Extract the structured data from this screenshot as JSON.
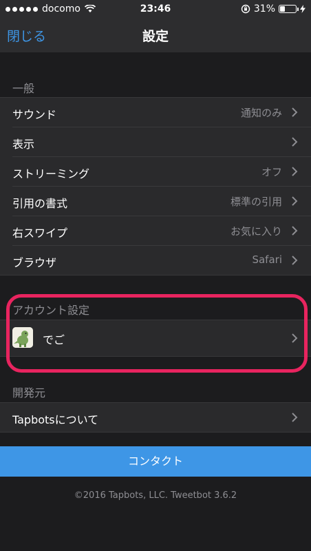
{
  "status_bar": {
    "carrier": "docomo",
    "time": "23:46",
    "battery": "31%",
    "battery_level": 0.31,
    "signal_bars": 5
  },
  "nav": {
    "close_label": "閉じる",
    "title": "設定"
  },
  "general": {
    "header": "一般",
    "items": [
      {
        "label": "サウンド",
        "value": "通知のみ"
      },
      {
        "label": "表示",
        "value": ""
      },
      {
        "label": "ストリーミング",
        "value": "オフ"
      },
      {
        "label": "引用の書式",
        "value": "標準の引用"
      },
      {
        "label": "右スワイプ",
        "value": "お気に入り"
      },
      {
        "label": "ブラウザ",
        "value": "Safari"
      }
    ]
  },
  "account": {
    "header": "アカウント設定",
    "name": "でご"
  },
  "developer": {
    "header": "開発元",
    "about_label": "Tapbotsについて"
  },
  "contact_label": "コンタクト",
  "footer": "©2016 Tapbots, LLC. Tweetbot 3.6.2",
  "colors": {
    "accent": "#3e96e6",
    "highlight": "#e8245f"
  }
}
